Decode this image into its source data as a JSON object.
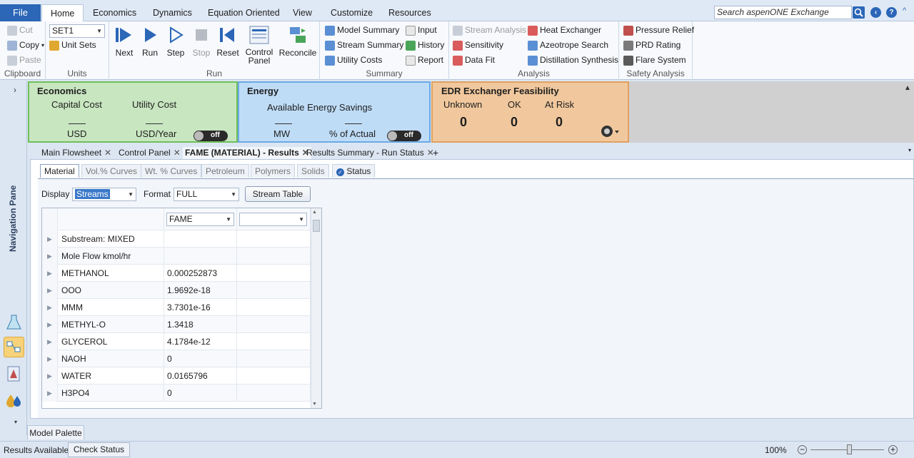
{
  "menu": {
    "file": "File",
    "tabs": [
      "Home",
      "Economics",
      "Dynamics",
      "Equation Oriented",
      "View",
      "Customize",
      "Resources"
    ],
    "search_placeholder": "Search aspenONE Exchange"
  },
  "ribbon": {
    "clipboard": {
      "cut": "Cut",
      "copy": "Copy",
      "paste": "Paste",
      "label": "Clipboard"
    },
    "units": {
      "set": "SET1",
      "unit_sets": "Unit Sets",
      "label": "Units"
    },
    "run": {
      "next": "Next",
      "run": "Run",
      "step": "Step",
      "stop": "Stop",
      "reset": "Reset",
      "control_panel_1": "Control",
      "control_panel_2": "Panel",
      "reconcile": "Reconcile",
      "label": "Run"
    },
    "summary": {
      "model_summary": "Model Summary",
      "stream_summary": "Stream Summary",
      "utility_costs": "Utility Costs",
      "input": "Input",
      "history": "History",
      "report": "Report",
      "label": "Summary"
    },
    "analysis": {
      "stream_analysis": "Stream Analysis",
      "sensitivity": "Sensitivity",
      "data_fit": "Data Fit",
      "heat_exchanger": "Heat Exchanger",
      "azeotrope_search": "Azeotrope Search",
      "distillation_synthesis": "Distillation Synthesis",
      "label": "Analysis"
    },
    "safety": {
      "pressure_relief": "Pressure Relief",
      "prd_rating": "PRD Rating",
      "flare_system": "Flare System",
      "label": "Safety Analysis"
    }
  },
  "nav": {
    "label": "Navigation Pane"
  },
  "dashboard": {
    "economics": {
      "title": "Economics",
      "capital_cost": "Capital Cost",
      "utility_cost": "Utility Cost",
      "usd": "USD",
      "usd_year": "USD/Year",
      "toggle": "off"
    },
    "energy": {
      "title": "Energy",
      "available": "Available Energy Savings",
      "mw": "MW",
      "pct_actual": "% of Actual",
      "toggle": "off"
    },
    "edr": {
      "title": "EDR Exchanger Feasibility",
      "unknown": "Unknown",
      "ok": "OK",
      "at_risk": "At Risk",
      "unknown_val": "0",
      "ok_val": "0",
      "at_risk_val": "0"
    }
  },
  "doc_tabs": [
    "Main Flowsheet",
    "Control Panel",
    "FAME (MATERIAL) - Results",
    "Results Summary - Run Status"
  ],
  "sub_tabs": [
    "Material",
    "Vol.% Curves",
    "Wt. % Curves",
    "Petroleum",
    "Polymers",
    "Solids",
    "Status"
  ],
  "controls": {
    "display_label": "Display",
    "display_value": "Streams",
    "format_label": "Format",
    "format_value": "FULL",
    "stream_table_button": "Stream Table"
  },
  "grid": {
    "stream_col": "FAME",
    "rows": [
      {
        "name": "Substream: MIXED",
        "value": ""
      },
      {
        "name": "Mole Flow kmol/hr",
        "value": ""
      },
      {
        "name": "METHANOL",
        "value": "0.000252873"
      },
      {
        "name": "OOO",
        "value": "1.9692e-18"
      },
      {
        "name": "MMM",
        "value": "3.7301e-16"
      },
      {
        "name": "METHYL-O",
        "value": "1.3418"
      },
      {
        "name": "GLYCEROL",
        "value": "4.1784e-12"
      },
      {
        "name": "NAOH",
        "value": "0"
      },
      {
        "name": "WATER",
        "value": "0.0165796"
      },
      {
        "name": "H3PO4",
        "value": "0"
      }
    ]
  },
  "bottom": {
    "palette": "Model Palette",
    "status": "Results Available",
    "check_status": "Check Status",
    "zoom": "100%"
  }
}
